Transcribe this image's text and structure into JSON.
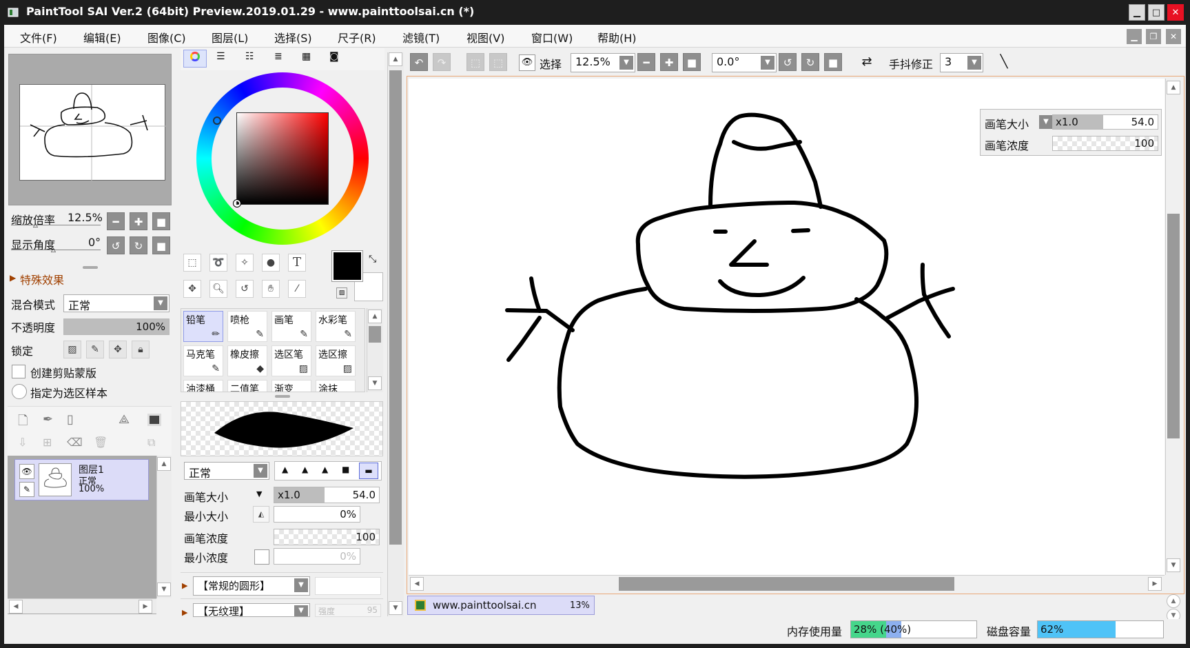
{
  "window": {
    "title": "PaintTool SAI Ver.2 (64bit) Preview.2019.01.29 - www.painttoolsai.cn (*)"
  },
  "menu": [
    "文件(F)",
    "编辑(E)",
    "图像(C)",
    "图层(L)",
    "选择(S)",
    "尺子(R)",
    "滤镜(T)",
    "视图(V)",
    "窗口(W)",
    "帮助(H)"
  ],
  "navigator": {
    "zoom_label": "缩放倍率",
    "zoom_value": "12.5%",
    "angle_label": "显示角度",
    "angle_value": "0°"
  },
  "layer_props": {
    "effects_label": "特殊效果",
    "blend_label": "混合模式",
    "blend_value": "正常",
    "opacity_label": "不透明度",
    "opacity_value": "100%",
    "opacity": 1.0,
    "lock_label": "锁定",
    "clip_label": "创建剪贴蒙版",
    "select_source_label": "指定为选区样本"
  },
  "layer": {
    "name": "图层1",
    "mode": "正常",
    "opacity": "100%"
  },
  "tools": [
    "铅笔",
    "喷枪",
    "画笔",
    "水彩笔",
    "马克笔",
    "橡皮擦",
    "选区笔",
    "选区擦",
    "油漆桶",
    "二值笔",
    "渐变",
    "涂抹"
  ],
  "brush": {
    "mode": "正常",
    "size_label": "画笔大小",
    "size_mult": "x1.0",
    "size_value": "54.0",
    "min_size_label": "最小大小",
    "min_size_value": "0%",
    "density_label": "画笔浓度",
    "density_value": "100",
    "min_density_label": "最小浓度",
    "min_density_value": "0%",
    "shape": "【常规的圆形】",
    "texture": "【无纹理】",
    "texture_strength_label": "强度",
    "texture_strength_value": "95"
  },
  "toolbar": {
    "select_label": "选择",
    "zoom_value": "12.5%",
    "angle_value": "0.0°",
    "stabilizer_label": "手抖修正",
    "stabilizer_value": "3"
  },
  "canvas_overlay": {
    "size_label": "画笔大小",
    "size_mult": "x1.0",
    "size_value": "54.0",
    "density_label": "画笔浓度",
    "density_value": "100"
  },
  "document_tab": {
    "name": "www.painttoolsai.cn",
    "zoom": "13%"
  },
  "status": {
    "memory_label": "内存使用量",
    "memory_text": "28% (40%)",
    "memory_used": 0.28,
    "memory_reserved": 0.4,
    "disk_label": "磁盘容量",
    "disk_text": "62%",
    "disk_used": 0.62
  },
  "colors": {
    "primary": "#000000",
    "secondary": "#ffffff",
    "hsv_square_hue": "#ff0000",
    "accent": "#4f7bd8"
  }
}
